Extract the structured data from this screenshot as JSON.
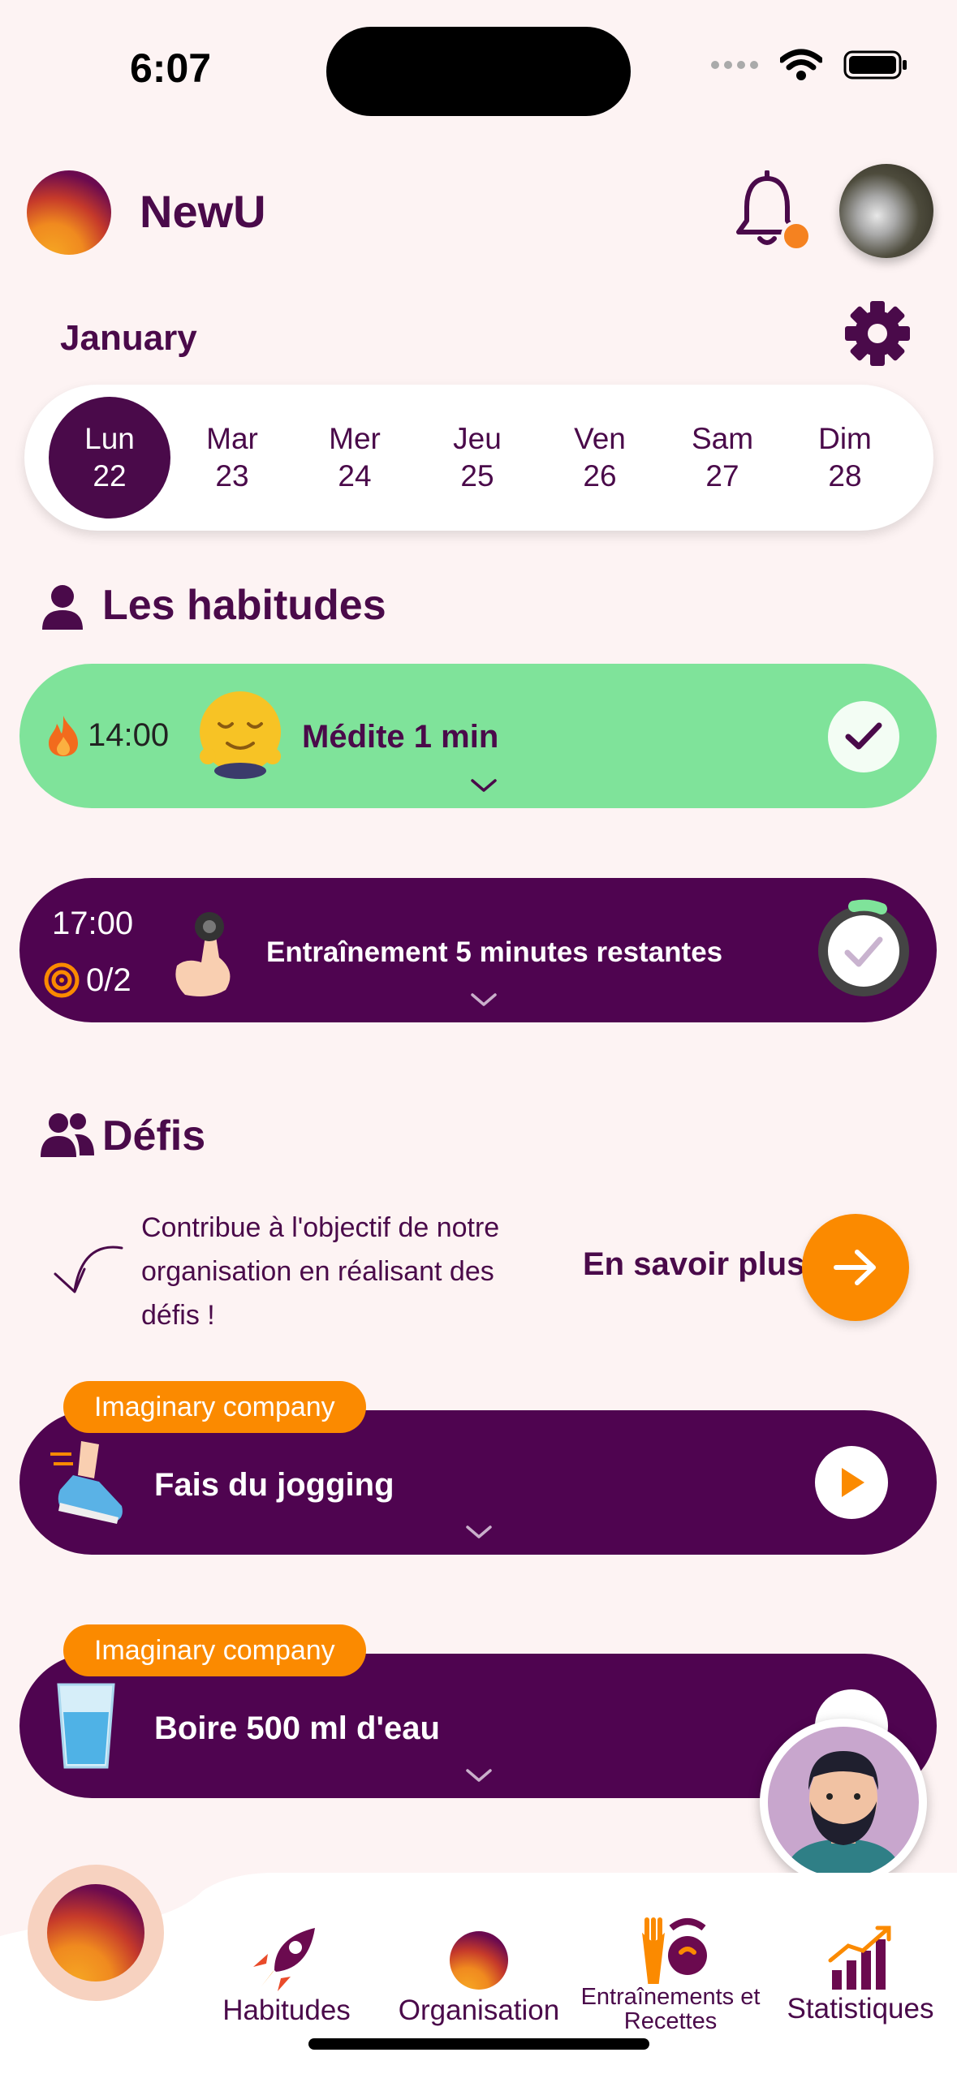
{
  "status_bar": {
    "time": "6:07"
  },
  "header": {
    "app_name": "NewU"
  },
  "calendar": {
    "month": "January",
    "days": [
      {
        "name": "Lun",
        "num": "22",
        "active": true
      },
      {
        "name": "Mar",
        "num": "23"
      },
      {
        "name": "Mer",
        "num": "24"
      },
      {
        "name": "Jeu",
        "num": "25"
      },
      {
        "name": "Ven",
        "num": "26"
      },
      {
        "name": "Sam",
        "num": "27"
      },
      {
        "name": "Dim",
        "num": "28"
      }
    ]
  },
  "habits": {
    "title": "Les habitudes",
    "items": [
      {
        "time": "14:00",
        "label": "Médite 1 min",
        "done": true
      },
      {
        "time": "17:00",
        "progress": "0/2",
        "label": "Entraînement 5 minutes restantes"
      }
    ]
  },
  "defis": {
    "title": "Défis",
    "description": "Contribue à l'objectif de notre organisation en réalisant des défis !",
    "learn_more": "En savoir plus",
    "challenges": [
      {
        "company": "Imaginary company",
        "label": "Fais du jogging"
      },
      {
        "company": "Imaginary company",
        "label": "Boire 500 ml d'eau"
      }
    ]
  },
  "bottom_nav": {
    "items": [
      {
        "label": "Habitudes"
      },
      {
        "label": "Organisation"
      },
      {
        "label": "Entraînements et Recettes"
      },
      {
        "label": "Statistiques"
      }
    ]
  },
  "colors": {
    "background": "#fdf3f3",
    "primary": "#4a0a4a",
    "card_purple": "#4f0450",
    "card_green": "#7fe39a",
    "accent": "#fb8a00"
  }
}
